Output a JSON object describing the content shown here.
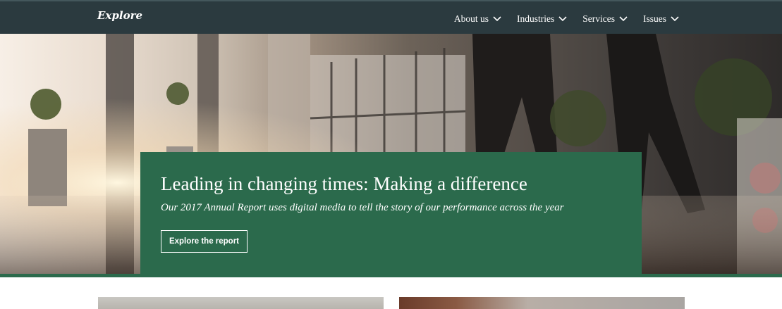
{
  "header": {
    "logo": "Explore",
    "nav": [
      {
        "label": "About us",
        "icon": "chevron-down-icon"
      },
      {
        "label": "Industries",
        "icon": "chevron-down-icon"
      },
      {
        "label": "Services",
        "icon": "chevron-down-icon"
      },
      {
        "label": "Issues",
        "icon": "chevron-down-icon"
      }
    ]
  },
  "hero": {
    "title": "Leading in changing times: Making a difference",
    "subtitle": "Our 2017 Annual Report uses digital media to tell the story of our performance across the year",
    "cta_label": "Explore the report"
  },
  "colors": {
    "topbar": "#2b3a3f",
    "accent_green": "#2b6a4c",
    "text_light": "#ffffff"
  }
}
